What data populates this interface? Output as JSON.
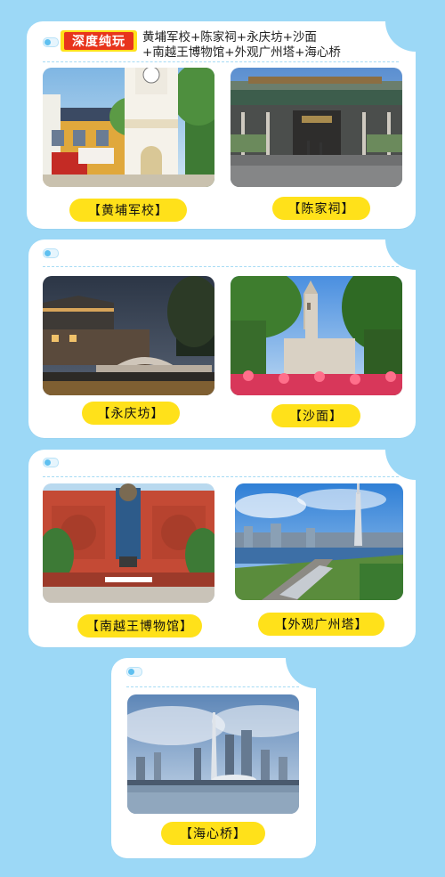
{
  "header": {
    "tag": "深度纯玩",
    "route_line1": "黄埔军校+陈家祠+永庆坊+沙面",
    "route_line2": "+南越王博物馆+外观广州塔+海心桥"
  },
  "cards": [
    {
      "places": [
        {
          "label": "【黄埔军校】",
          "image": "huangpu-military-academy-photo"
        },
        {
          "label": "【陈家祠】",
          "image": "chen-clan-ancestral-hall-photo"
        }
      ]
    },
    {
      "places": [
        {
          "label": "【永庆坊】",
          "image": "yongqingfang-photo"
        },
        {
          "label": "【沙面】",
          "image": "shamian-photo"
        }
      ]
    },
    {
      "places": [
        {
          "label": "【南越王博物馆】",
          "image": "nanyue-king-museum-photo"
        },
        {
          "label": "【外观广州塔】",
          "image": "canton-tower-photo"
        }
      ]
    },
    {
      "places": [
        {
          "label": "【海心桥】",
          "image": "haixin-bridge-photo"
        }
      ]
    }
  ],
  "colors": {
    "background": "#9cd8f6",
    "card": "#ffffff",
    "pill": "#ffe11a",
    "tag": "#e8341c"
  }
}
